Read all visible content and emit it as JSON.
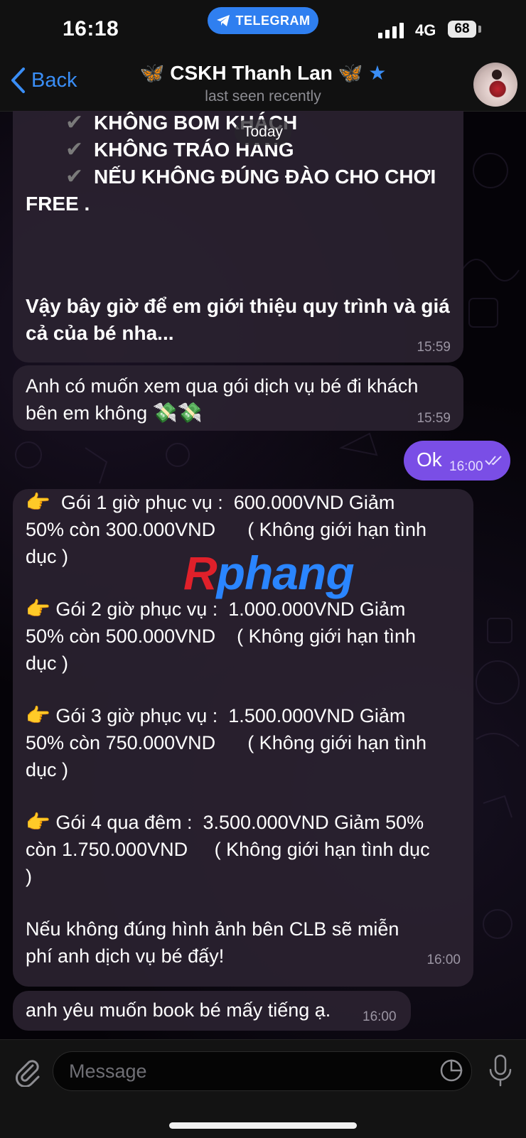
{
  "status_bar": {
    "time": "16:18",
    "app_pill": "TELEGRAM",
    "network": "4G",
    "battery": "68"
  },
  "header": {
    "back_label": "Back",
    "title_name": "CSKH Thanh Lan",
    "subtitle": "last seen recently"
  },
  "date_separator": "Today",
  "messages": [
    {
      "lines": [
        "KHÔNG BOM KHÁCH",
        "KHÔNG TRÁO HANG",
        "NẾU KHÔNG ĐÚNG ĐÀO CHO CHƠI",
        "FREE .",
        "Vậy bây giờ để em giới thiệu quy trình và giá",
        "cả của bé nha..."
      ],
      "time": "15:59"
    },
    {
      "lines": [
        "Anh có muốn xem qua gói dịch vụ bé đi khách",
        "bên em không"
      ],
      "time": "15:59"
    },
    {
      "text": "Ok",
      "time": "16:00",
      "outgoing": true
    },
    {
      "lines": [
        "Gói 1 giờ phục vụ :  600.000VND Giảm",
        "50% còn 300.000VND      ( Không giới hạn tình",
        "dục )",
        "Gói 2 giờ phục vụ :  1.000.000VND Giảm",
        "50% còn 500.000VND    ( Không giới hạn tình",
        "dục )",
        "Gói 3 giờ phục vụ :  1.500.000VND Giảm",
        "50% còn 750.000VND      ( Không giới hạn tình",
        "dục )",
        "Gói 4 qua đêm :  3.500.000VND Giảm 50%",
        "còn 1.750.000VND     ( Không giới hạn tình dục",
        ")",
        "Nếu không đúng hình ảnh bên CLB sẽ miễn",
        "phí anh dịch vụ bé đấy!"
      ],
      "time": "16:00"
    },
    {
      "text": "anh yêu muốn book bé mấy tiếng ạ.",
      "time": "16:00"
    }
  ],
  "watermark": {
    "first": "R",
    "rest": "phang"
  },
  "composer": {
    "placeholder": "Message"
  },
  "colors": {
    "accent": "#3a8ef6",
    "outgoing_bubble": "#7a4ee6",
    "incoming_bubble": "#2a2230"
  }
}
